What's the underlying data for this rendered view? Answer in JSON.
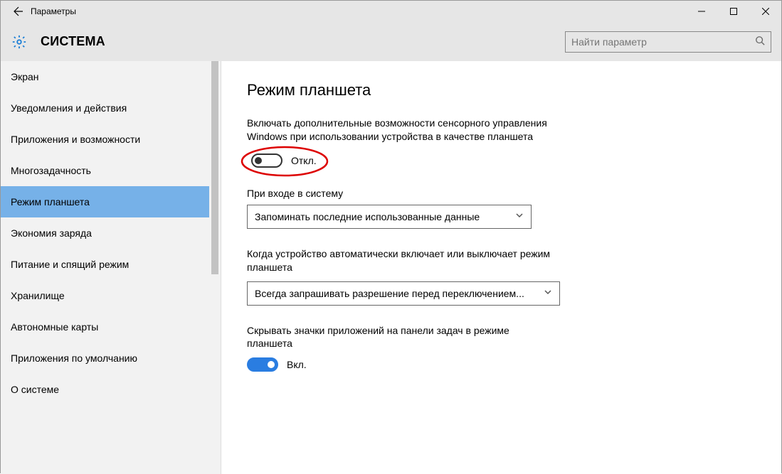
{
  "window": {
    "title": "Параметры"
  },
  "header": {
    "section": "СИСТЕМА",
    "search_placeholder": "Найти параметр"
  },
  "sidebar": {
    "items": [
      "Экран",
      "Уведомления и действия",
      "Приложения и возможности",
      "Многозадачность",
      "Режим планшета",
      "Экономия заряда",
      "Питание и спящий режим",
      "Хранилище",
      "Автономные карты",
      "Приложения по умолчанию",
      "О системе"
    ],
    "selected_index": 4
  },
  "main": {
    "title": "Режим планшета",
    "desc1": "Включать дополнительные возможности сенсорного управления Windows при использовании устройства в качестве планшета",
    "toggle1_state": "Откл.",
    "toggle1_on": false,
    "label1": "При входе в систему",
    "select1": "Запоминать последние использованные данные",
    "desc2": "Когда устройство автоматически включает или выключает режим планшета",
    "select2": "Всегда запрашивать разрешение перед переключением...",
    "desc3": "Скрывать значки приложений на панели задач в режиме планшета",
    "toggle2_state": "Вкл.",
    "toggle2_on": true
  }
}
